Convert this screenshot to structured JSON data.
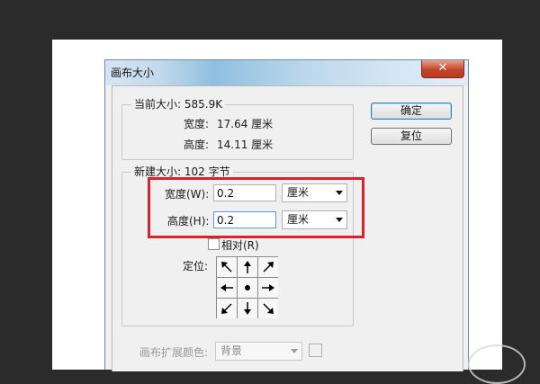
{
  "dialog": {
    "title": "画布大小",
    "close_symbol": "✕"
  },
  "current_size": {
    "legend": "当前大小: 585.9K",
    "width_label": "宽度:",
    "width_value": "17.64 厘米",
    "height_label": "高度:",
    "height_value": "14.11 厘米"
  },
  "new_size": {
    "legend": "新建大小: 102 字节",
    "width_label": "宽度(W):",
    "width_value": "0.2",
    "width_unit": "厘米",
    "height_label": "高度(H):",
    "height_value": "0.2",
    "height_unit": "厘米",
    "relative_label": "相对(R)",
    "relative_checked": false,
    "anchor_label": "定位:",
    "anchor_cells": [
      "arrow-nw-icon",
      "arrow-n-icon",
      "arrow-ne-icon",
      "arrow-w-icon",
      "anchor-dot-icon",
      "arrow-e-icon",
      "arrow-sw-icon",
      "arrow-s-icon",
      "arrow-se-icon"
    ]
  },
  "buttons": {
    "ok": "确定",
    "reset": "复位"
  },
  "extension": {
    "label": "画布扩展颜色:",
    "value": "背景"
  },
  "colors": {
    "highlight": "#d8232a",
    "background": "#2b2b2b"
  }
}
